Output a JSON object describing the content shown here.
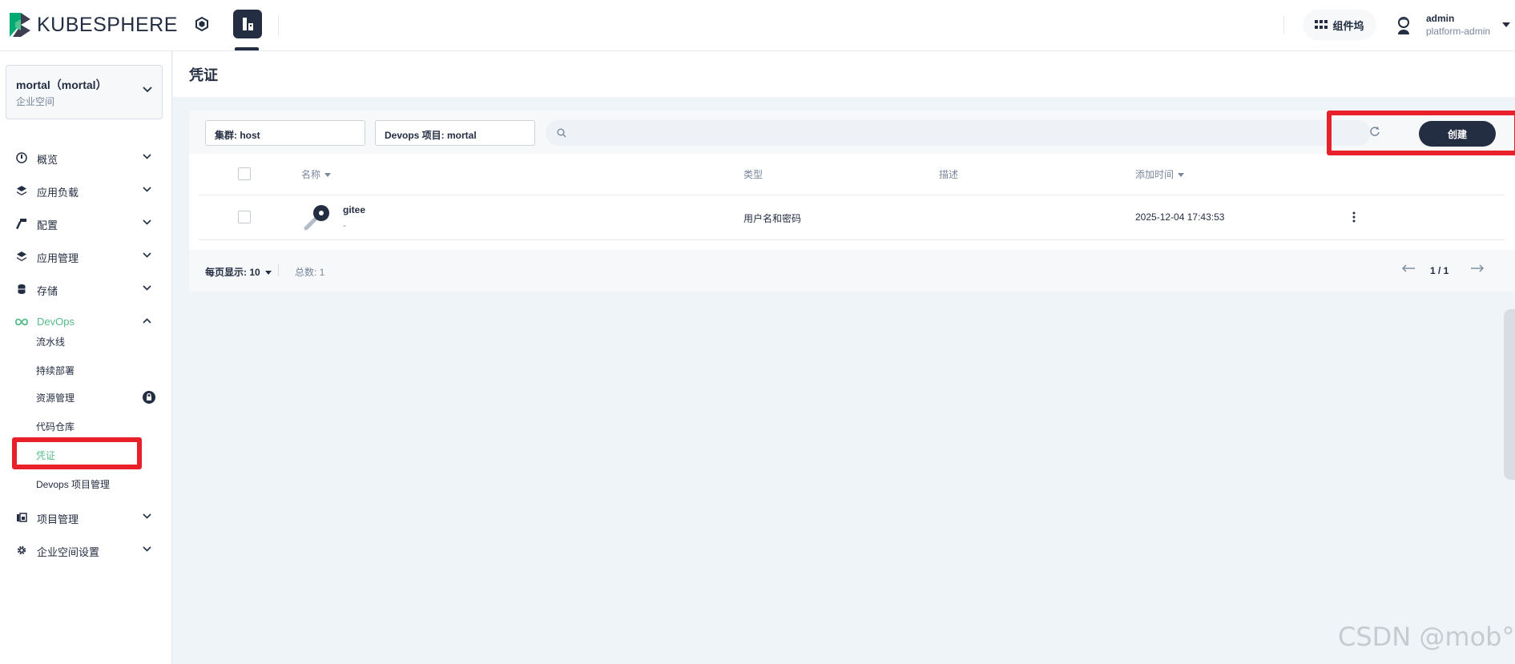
{
  "brand": {
    "name": "KUBESPHERE"
  },
  "topbar": {
    "component_label": "组件坞",
    "user_name": "admin",
    "user_role": "platform-admin"
  },
  "workspace": {
    "title": "mortal（mortal）",
    "subtitle": "企业空间"
  },
  "sidebar": {
    "items": [
      {
        "label": "概览",
        "icon": "dashboard-icon"
      },
      {
        "label": "应用负载",
        "icon": "appcenter-icon"
      },
      {
        "label": "配置",
        "icon": "hammer-icon"
      },
      {
        "label": "应用管理",
        "icon": "appcenter-icon"
      },
      {
        "label": "存储",
        "icon": "storage-icon"
      },
      {
        "label": "DevOps",
        "icon": "infinity-icon"
      },
      {
        "label": "项目管理",
        "icon": "project-icon"
      },
      {
        "label": "企业空间设置",
        "icon": "gear-icon"
      }
    ],
    "devops_sub": [
      "流水线",
      "持续部署",
      "资源管理",
      "代码仓库",
      "凭证",
      "Devops 项目管理"
    ]
  },
  "page": {
    "title": "凭证"
  },
  "toolbar": {
    "cluster_filter": "集群: host",
    "project_filter": "Devops 项目: mortal",
    "create_label": "创建"
  },
  "table": {
    "headers": {
      "name": "名称",
      "type": "类型",
      "description": "描述",
      "created": "添加时间"
    },
    "rows": [
      {
        "name": "gitee",
        "subtitle": "-",
        "type": "用户名和密码",
        "description": "",
        "created": "2025-12-04 17:43:53"
      }
    ]
  },
  "pagination": {
    "per_page": "每页显示: 10",
    "total": "总数: 1",
    "page": "1 / 1"
  },
  "watermark": "CSDN @mob°",
  "colors": {
    "accent": "#55bc8a",
    "dark": "#242e42",
    "highlight": "#e8202a"
  }
}
